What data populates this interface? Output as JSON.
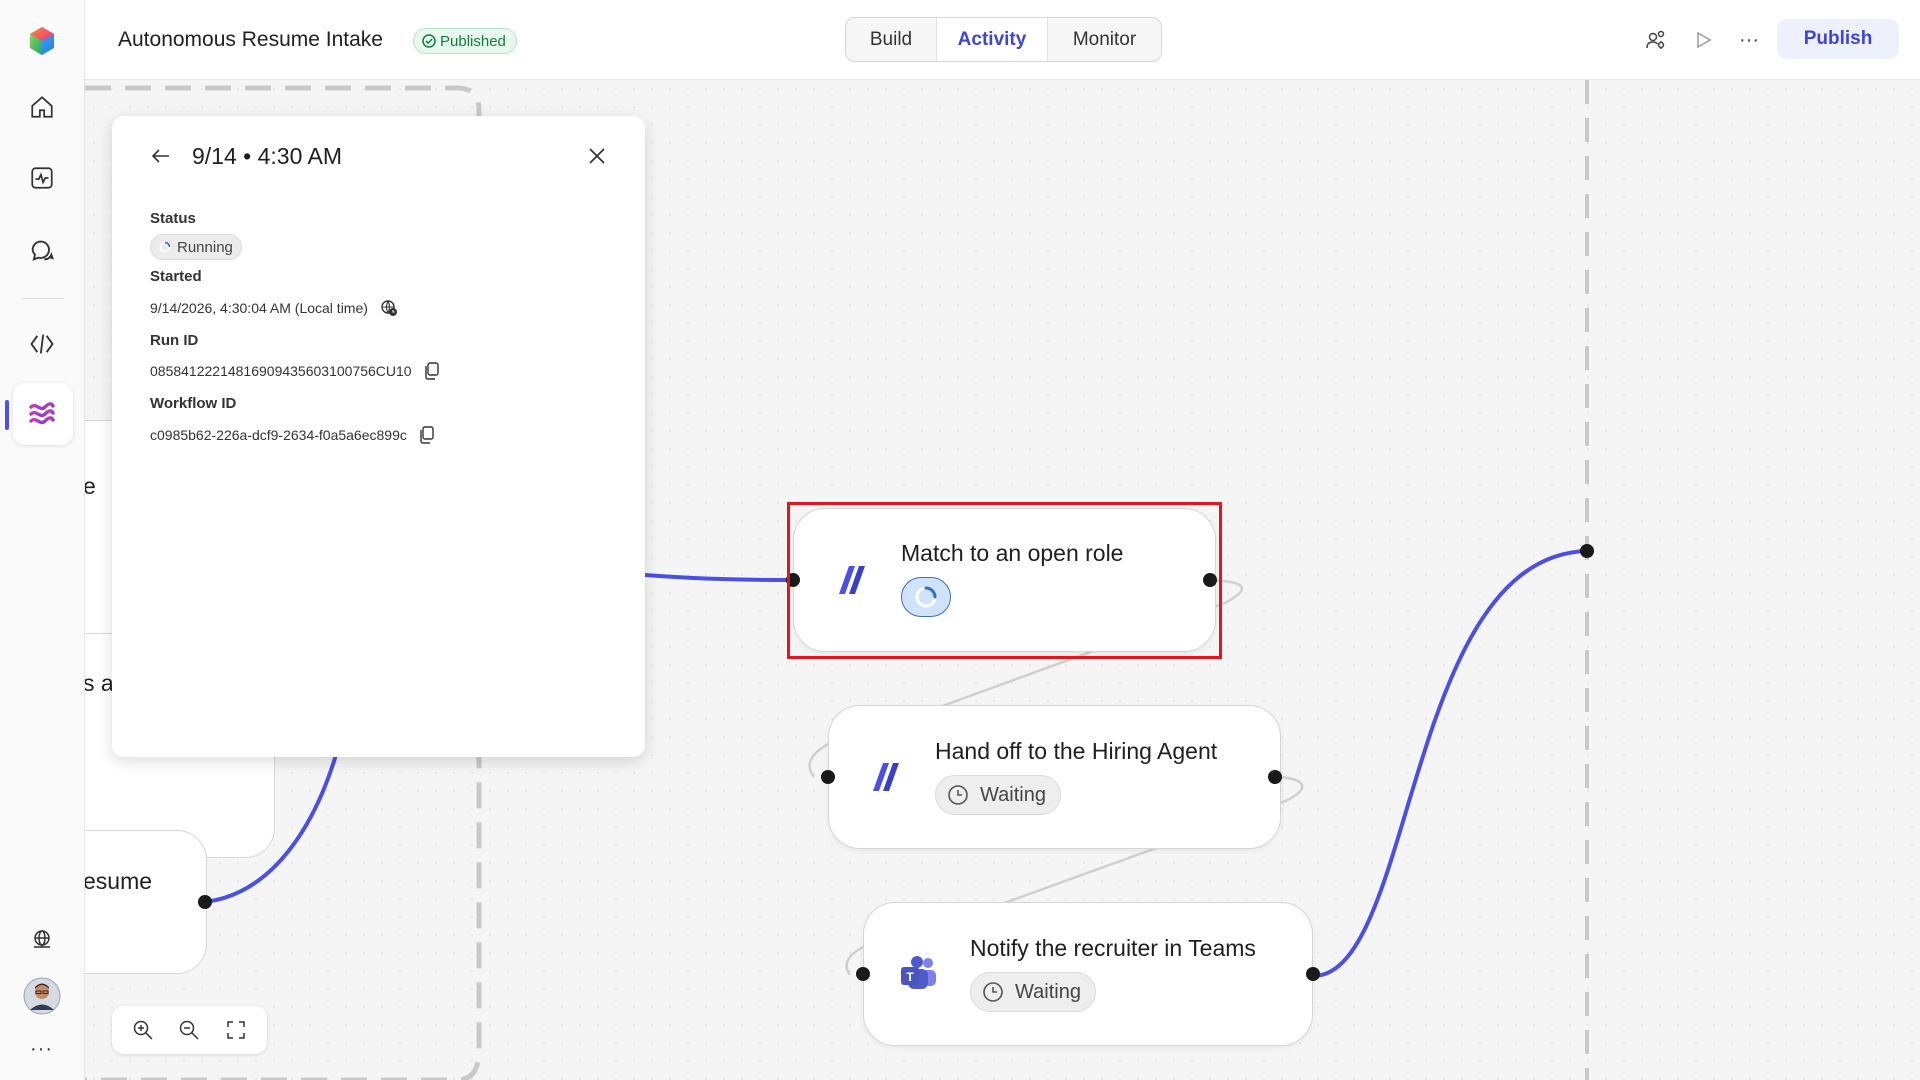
{
  "app": {
    "title": "Autonomous Resume Intake",
    "status_badge": "Published"
  },
  "tabs": [
    {
      "label": "Build",
      "active": false
    },
    {
      "label": "Activity",
      "active": true
    },
    {
      "label": "Monitor",
      "active": false
    }
  ],
  "toolbar": {
    "publish_label": "Publish",
    "more_label": "···"
  },
  "rail": {
    "more_label": "···"
  },
  "panel": {
    "title": "9/14 • 4:30 AM",
    "status_label": "Status",
    "status_value": "Running",
    "started_label": "Started",
    "started_value": "9/14/2026, 4:30:04 AM (Local time)",
    "run_id_label": "Run ID",
    "run_id_value": "08584122214816909435603100756CU10",
    "workflow_id_label": "Workflow ID",
    "workflow_id_value": "c0985b62-226a-dcf9-2634-f0a5a6ec899c"
  },
  "partial_nodes": [
    {
      "text": "e"
    },
    {
      "text": "s a"
    },
    {
      "text": "esume"
    }
  ],
  "nodes": [
    {
      "title": "Match to an open role",
      "status": "running",
      "selected": true
    },
    {
      "title": "Hand off to the Hiring Agent",
      "status": "Waiting"
    },
    {
      "title": "Notify the recruiter in Teams",
      "status": "Waiting"
    }
  ],
  "colors": {
    "accent": "#3f46d6",
    "wire": "#4a50e0",
    "highlight": "#e8141d",
    "published": "#107c41"
  }
}
